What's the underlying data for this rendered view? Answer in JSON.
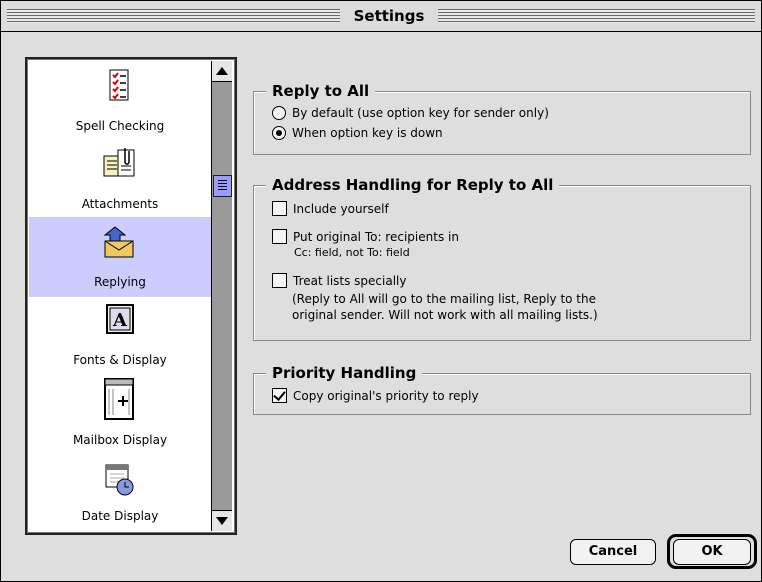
{
  "window": {
    "title": "Settings"
  },
  "sidebar": {
    "items": [
      {
        "label": "Spell Checking",
        "icon": "spell-checking-icon"
      },
      {
        "label": "Attachments",
        "icon": "attachments-icon"
      },
      {
        "label": "Replying",
        "icon": "replying-icon",
        "selected": true
      },
      {
        "label": "Fonts & Display",
        "icon": "fonts-display-icon"
      },
      {
        "label": "Mailbox Display",
        "icon": "mailbox-display-icon"
      },
      {
        "label": "Date Display",
        "icon": "date-display-icon"
      }
    ]
  },
  "reply_to_all": {
    "title": "Reply to All",
    "options": [
      {
        "label": "By default (use option key for sender only)",
        "selected": false
      },
      {
        "label": "When option key is down",
        "selected": true
      }
    ]
  },
  "address_handling": {
    "title": "Address Handling for Reply to All",
    "include_yourself": {
      "label": "Include yourself",
      "checked": false
    },
    "put_original": {
      "label": "Put original To: recipients in",
      "sub": "Cc: field, not To: field",
      "checked": false
    },
    "treat_lists": {
      "label": "Treat lists specially",
      "checked": false,
      "note_line1": "(Reply to All will go to the mailing list, Reply to the",
      "note_line2": "original sender.  Will not work with all mailing lists.)"
    }
  },
  "priority_handling": {
    "title": "Priority Handling",
    "copy_priority": {
      "label": "Copy original's priority to reply",
      "checked": true
    }
  },
  "buttons": {
    "cancel": "Cancel",
    "ok": "OK"
  },
  "colors": {
    "selection": "#ccccff",
    "window_bg": "#dedede",
    "scroll_thumb": "#9a9aff"
  }
}
